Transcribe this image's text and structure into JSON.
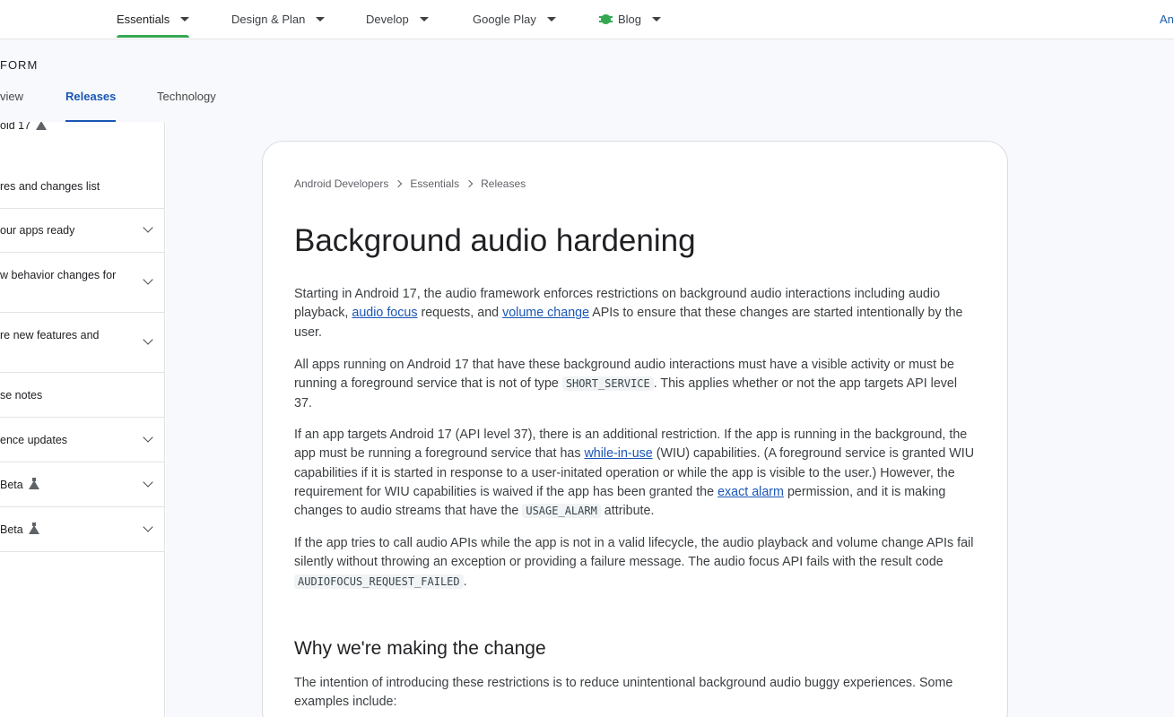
{
  "topnav": {
    "items": [
      {
        "label": "Essentials",
        "active": true
      },
      {
        "label": "Design & Plan"
      },
      {
        "label": "Develop"
      },
      {
        "label": "Google Play"
      },
      {
        "label": "Blog"
      }
    ],
    "right_text": "An"
  },
  "subheader": {
    "section_label": "FORM",
    "tabs": [
      {
        "label": "view"
      },
      {
        "label": "Releases",
        "active": true
      },
      {
        "label": "Technology"
      }
    ]
  },
  "sidebar": {
    "items": [
      {
        "label": "oid 17"
      },
      {
        "label": "res and changes list"
      },
      {
        "label": "our apps ready"
      },
      {
        "label_lines": [
          "w behavior changes for",
          ""
        ]
      },
      {
        "label_lines": [
          "re new features and",
          ""
        ]
      },
      {
        "label": "se notes"
      },
      {
        "label": "ence updates"
      },
      {
        "label": "Beta"
      },
      {
        "label": "Beta"
      }
    ]
  },
  "breadcrumb": [
    "Android Developers",
    "Essentials",
    "Releases"
  ],
  "article": {
    "title": "Background audio hardening",
    "p1": {
      "t1": "Starting in Android 17, the audio framework enforces restrictions on background audio interactions including audio playback, ",
      "link1": "audio focus",
      "t2": " requests, and ",
      "link2": "volume change",
      "t3": " APIs to ensure that these changes are started intentionally by the user."
    },
    "p2": {
      "t1": "All apps running on Android 17 that have these background audio interactions must have a visible activity or must be running a foreground service that is not of type ",
      "code1": "SHORT_SERVICE",
      "t2": ". This applies whether or not the app targets API level 37."
    },
    "p3": {
      "t1": "If an app targets Android 17 (API level 37), there is an additional restriction. If the app is running in the background, the app must be running a foreground service that has ",
      "link1": "while-in-use",
      "t2": " (WIU) capabilities. (A foreground service is granted WIU capabilities if it is started in response to a user-initated operation or while the app is visible to the user.) However, the requirement for WIU capabilities is waived if the app has been granted the ",
      "link2": "exact alarm",
      "t3": " permission, and it is making changes to audio streams that have the ",
      "code1": "USAGE_ALARM",
      "t4": " attribute."
    },
    "p4": {
      "t1": "If the app tries to call audio APIs while the app is not in a valid lifecycle, the audio playback and volume change APIs fail silently without throwing an exception or providing a failure message. The audio focus API fails with the result code ",
      "code1": "AUDIOFOCUS_REQUEST_FAILED",
      "t2": "."
    },
    "h2": "Why we're making the change",
    "p5": "The intention of introducing these restrictions is to reduce unintentional background audio buggy experiences. Some examples include:"
  }
}
